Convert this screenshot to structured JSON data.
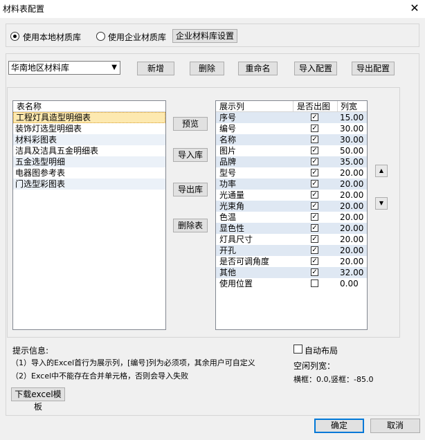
{
  "window": {
    "title": "材料表配置",
    "close": "✕"
  },
  "source": {
    "local_label": "使用本地材质库",
    "enterprise_label": "使用企业材质库",
    "settings_button": "企业材料库设置"
  },
  "library": {
    "selected": "华南地区材料库",
    "buttons": {
      "new": "新增",
      "delete": "删除",
      "rename": "重命名",
      "import": "导入配置",
      "export": "导出配置"
    }
  },
  "tables": {
    "header": "表名称",
    "items": [
      "工程灯具造型明细表",
      "装饰灯选型明细表",
      "材料彩图表",
      "洁具及洁具五金明细表",
      "五金选型明细",
      "电器图参考表",
      "门选型彩图表"
    ]
  },
  "actions": {
    "preview": "预览",
    "import_lib": "导入库",
    "export_lib": "导出库",
    "delete_table": "删除表"
  },
  "columns": {
    "headers": [
      "展示列",
      "是否出图",
      "列宽"
    ],
    "rows": [
      {
        "name": "序号",
        "checked": true,
        "width": "15.00"
      },
      {
        "name": "编号",
        "checked": true,
        "width": "30.00"
      },
      {
        "name": "名称",
        "checked": true,
        "width": "30.00"
      },
      {
        "name": "图片",
        "checked": true,
        "width": "50.00"
      },
      {
        "name": "品牌",
        "checked": true,
        "width": "35.00"
      },
      {
        "name": "型号",
        "checked": true,
        "width": "20.00"
      },
      {
        "name": "功率",
        "checked": true,
        "width": "20.00"
      },
      {
        "name": "光通量",
        "checked": true,
        "width": "20.00"
      },
      {
        "name": "光束角",
        "checked": true,
        "width": "20.00"
      },
      {
        "name": "色温",
        "checked": true,
        "width": "20.00"
      },
      {
        "name": "显色性",
        "checked": true,
        "width": "20.00"
      },
      {
        "name": "灯具尺寸",
        "checked": true,
        "width": "20.00"
      },
      {
        "name": "开孔",
        "checked": true,
        "width": "20.00"
      },
      {
        "name": "是否可调角度",
        "checked": true,
        "width": "20.00"
      },
      {
        "name": "其他",
        "checked": true,
        "width": "32.00"
      },
      {
        "name": "使用位置",
        "checked": false,
        "width": "0.00"
      }
    ]
  },
  "hints": {
    "title": "提示信息:",
    "line1": "（1）导入的Excel首行为展示列，[编号]列为必须项，其余用户可自定义",
    "line2": "（2）Excel中不能存在合并单元格，否则会导入失败",
    "download_button": "下载excel模板"
  },
  "layout_options": {
    "auto_layout": "自动布局",
    "free_width_label": "空闲列宽：",
    "frame_info": "横框：0.0,竖框：-85.0"
  },
  "footer": {
    "ok": "确定",
    "cancel": "取消"
  },
  "icons": {
    "up": "▲",
    "down": "▼",
    "dropdown": "▼",
    "check": "✓"
  }
}
